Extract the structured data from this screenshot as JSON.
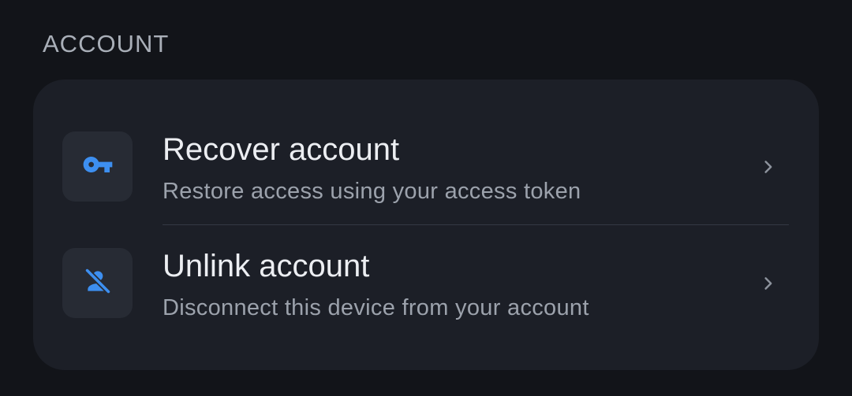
{
  "section": {
    "title": "ACCOUNT"
  },
  "items": [
    {
      "title": "Recover account",
      "subtitle": "Restore access using your access token",
      "icon": "key-icon"
    },
    {
      "title": "Unlink account",
      "subtitle": "Disconnect this device from your account",
      "icon": "person-off-icon"
    }
  ],
  "colors": {
    "background": "#121419",
    "card": "#1c1f27",
    "icon_tile": "#272b34",
    "accent": "#3d8ff0",
    "title_text": "#eceef2",
    "subtitle_text": "#9ca2ac",
    "header_text": "#a9afb8"
  }
}
